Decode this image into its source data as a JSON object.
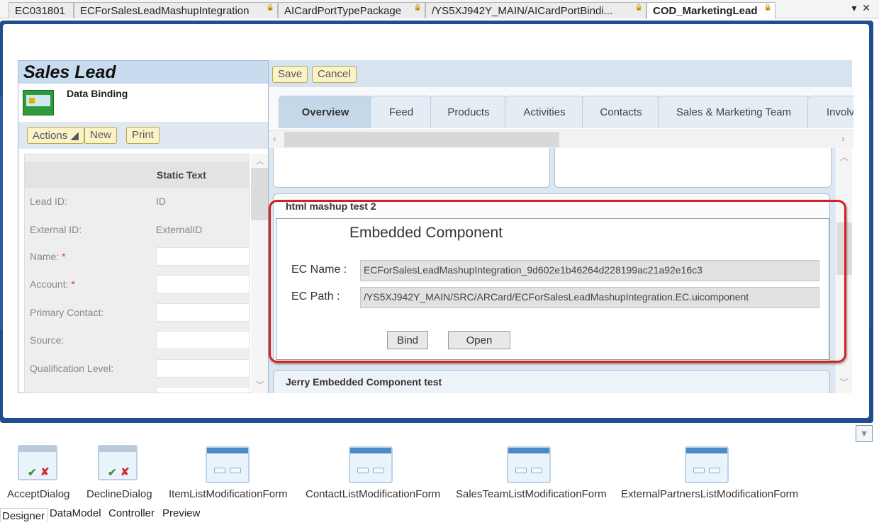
{
  "doc_tabs": [
    {
      "label": "EC031801",
      "pinned": false,
      "active": false
    },
    {
      "label": "ECForSalesLeadMashupIntegration",
      "pinned": true,
      "active": false
    },
    {
      "label": "AICardPortTypePackage",
      "pinned": true,
      "active": false
    },
    {
      "label": "/YS5XJ942Y_MAIN/AICardPortBindi...",
      "pinned": true,
      "active": false
    },
    {
      "label": "COD_MarketingLead",
      "pinned": true,
      "active": true
    }
  ],
  "tab_controls": "▾ ✕",
  "left_panel": {
    "title": "Sales Lead",
    "subtitle": "Data Binding",
    "toolbar": {
      "actions_label": "Actions ◢",
      "new_label": "New",
      "print_label": "Print"
    },
    "form_header": "Static Text",
    "fields": [
      {
        "label": "Lead ID:",
        "value": "ID",
        "required": false
      },
      {
        "label": "External ID:",
        "value": "ExternalID",
        "required": false
      },
      {
        "label": "Name:",
        "value": "",
        "required": true
      },
      {
        "label": "Account:",
        "value": "",
        "required": true
      },
      {
        "label": "Primary Contact:",
        "value": "",
        "required": false
      },
      {
        "label": "Source:",
        "value": "",
        "required": false
      },
      {
        "label": "Qualification Level:",
        "value": "",
        "required": false
      }
    ]
  },
  "right_toolbar": {
    "save_label": "Save",
    "cancel_label": "Cancel"
  },
  "content_tabs": [
    "Overview",
    "Feed",
    "Products",
    "Activities",
    "Contacts",
    "Sales & Marketing Team",
    "Involv"
  ],
  "active_tab": "Overview",
  "section1_title": "html mashup test 2",
  "embedded_component": {
    "title": "Embedded Component",
    "ec_name_label": "EC Name :",
    "ec_name_value": "ECForSalesLeadMashupIntegration_9d602e1b46264d228199ac21a92e16c3",
    "ec_path_label": "EC Path :",
    "ec_path_value": "/YS5XJ942Y_MAIN/SRC/ARCard/ECForSalesLeadMashupIntegration.EC.uicomponent",
    "bind_label": "Bind",
    "open_label": "Open"
  },
  "section2_title": "Jerry Embedded Component test",
  "bottom_items": [
    {
      "label": "AcceptDialog",
      "kind": "dialog"
    },
    {
      "label": "DeclineDialog",
      "kind": "dialog"
    },
    {
      "label": "ItemListModificationForm",
      "kind": "form"
    },
    {
      "label": "ContactListModificationForm",
      "kind": "form"
    },
    {
      "label": "SalesTeamListModificationForm",
      "kind": "form"
    },
    {
      "label": "ExternalPartnersListModificationForm",
      "kind": "form"
    }
  ],
  "view_tabs": [
    "Designer",
    "DataModel",
    "Controller",
    "Preview"
  ],
  "active_view": "Designer",
  "colors": {
    "frame": "#1f4e8f",
    "highlight_ring": "#d81f1f",
    "yellow_button": "#fbf3c8"
  }
}
